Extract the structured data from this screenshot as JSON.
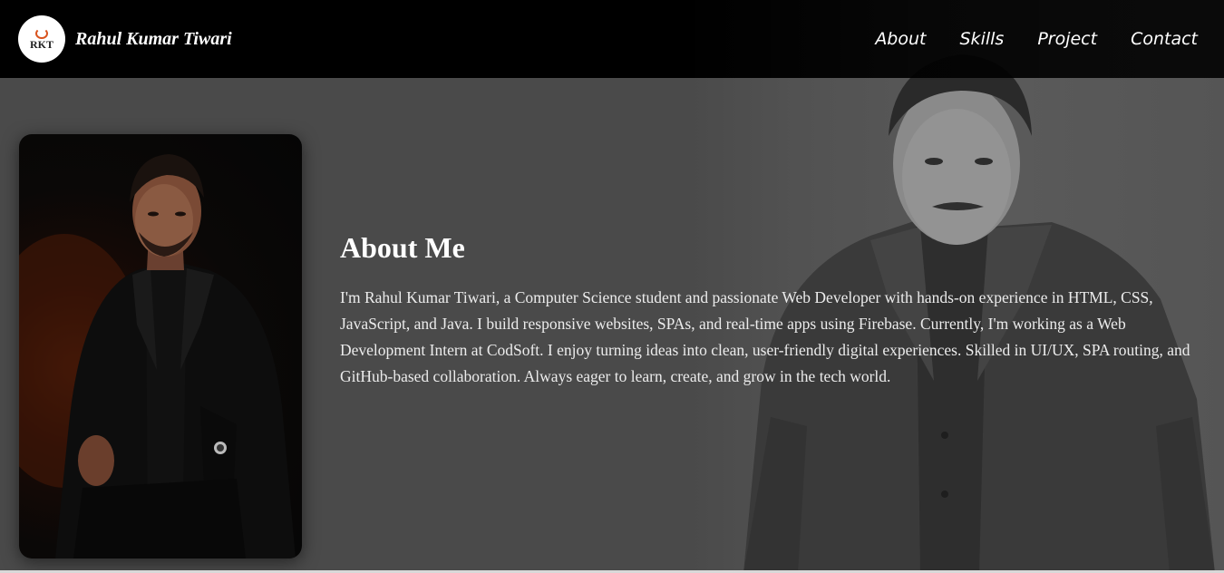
{
  "brand": {
    "logo_text": "RKT",
    "name": "Rahul Kumar Tiwari"
  },
  "nav": {
    "items": [
      {
        "label": "About"
      },
      {
        "label": "Skills"
      },
      {
        "label": "Project"
      },
      {
        "label": "Contact"
      }
    ]
  },
  "about": {
    "title": "About Me",
    "text": "I'm Rahul Kumar Tiwari, a Computer Science student and passionate Web Developer with hands-on experience in HTML, CSS, JavaScript, and Java. I build responsive websites, SPAs, and real-time apps using Firebase. Currently, I'm working as a Web Development Intern at CodSoft. I enjoy turning ideas into clean, user-friendly digital experiences. Skilled in UI/UX, SPA routing, and GitHub-based collaboration. Always eager to learn, create, and grow in the tech world."
  },
  "colors": {
    "navbar_bg": "#000000",
    "page_bg": "#4a4a4a",
    "text": "#ffffff",
    "logo_accent": "#d9531e"
  }
}
